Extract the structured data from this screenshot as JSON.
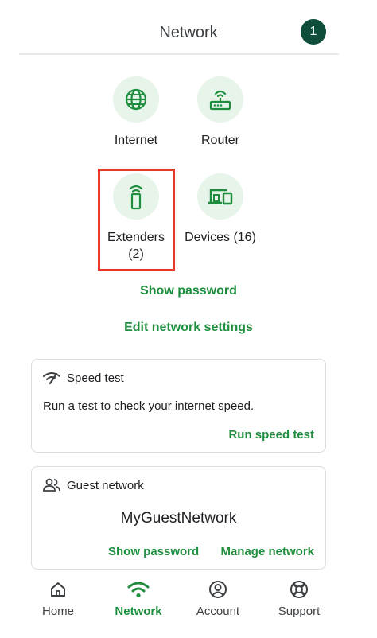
{
  "header": {
    "title": "Network",
    "notification_count": "1"
  },
  "tiles": {
    "internet": {
      "label": "Internet",
      "icon": "globe-icon"
    },
    "router": {
      "label": "Router",
      "icon": "router-icon"
    },
    "extenders": {
      "label_line1": "Extenders",
      "label_line2": "(2)",
      "icon": "extender-icon"
    },
    "devices": {
      "label": "Devices (16)",
      "icon": "devices-icon"
    }
  },
  "links": {
    "show_password": "Show password",
    "edit_network_settings": "Edit network settings"
  },
  "speed_test_card": {
    "title": "Speed test",
    "description": "Run a test to check your internet speed.",
    "action": "Run speed test",
    "icon": "speed-icon"
  },
  "guest_network_card": {
    "title": "Guest network",
    "network_name": "MyGuestNetwork",
    "show_password": "Show password",
    "manage_network": "Manage network",
    "icon": "people-icon"
  },
  "bottom_nav": {
    "items": [
      {
        "label": "Home",
        "icon": "home-icon",
        "active": false
      },
      {
        "label": "Network",
        "icon": "wifi-icon",
        "active": true
      },
      {
        "label": "Account",
        "icon": "account-icon",
        "active": false
      },
      {
        "label": "Support",
        "icon": "support-icon",
        "active": false
      }
    ]
  },
  "colors": {
    "accent": "#1e8e3e",
    "badge": "#0d4d3a",
    "tile_bg": "#e6f4ea",
    "highlight": "#e53a2b"
  }
}
